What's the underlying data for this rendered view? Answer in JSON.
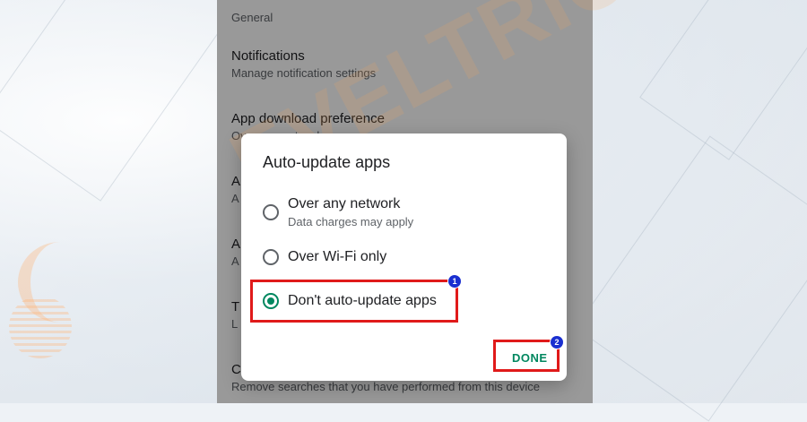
{
  "background": {
    "watermark": "EVELTRICKS"
  },
  "settings": {
    "section_label": "General",
    "items": [
      {
        "title": "Notifications",
        "subtitle": "Manage notification settings"
      },
      {
        "title": "App download preference",
        "subtitle": "Over any network"
      },
      {
        "title": "A",
        "subtitle": "A"
      },
      {
        "title": "A",
        "subtitle": "A"
      },
      {
        "title": "T",
        "subtitle": "L"
      },
      {
        "title": "C",
        "subtitle": "Remove searches that you have performed from this device"
      }
    ]
  },
  "dialog": {
    "title": "Auto-update apps",
    "options": [
      {
        "label": "Over any network",
        "subtitle": "Data charges may apply",
        "selected": false
      },
      {
        "label": "Over Wi-Fi only",
        "subtitle": "",
        "selected": false
      },
      {
        "label": "Don't auto-update apps",
        "subtitle": "",
        "selected": true
      }
    ],
    "done_label": "DONE"
  },
  "annotations": {
    "step1": "1",
    "step2": "2"
  },
  "colors": {
    "accent": "#01875f",
    "highlight": "#e01a1a",
    "badge": "#1a2fd0"
  }
}
